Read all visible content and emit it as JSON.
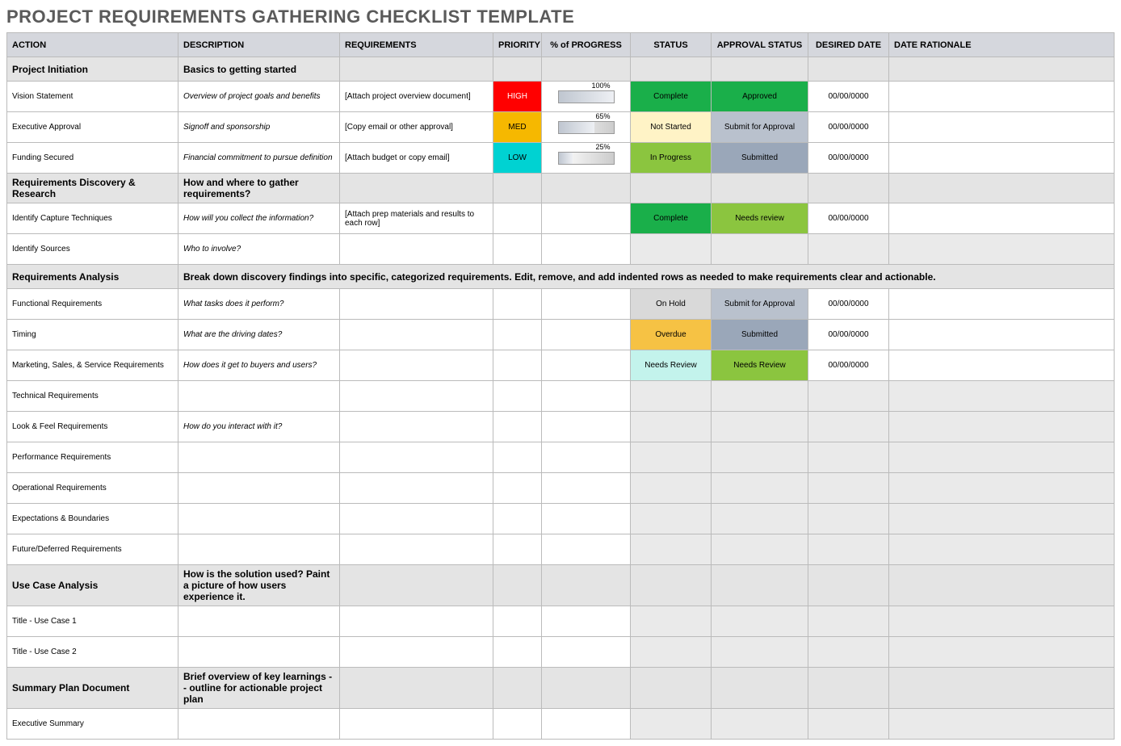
{
  "title": "PROJECT REQUIREMENTS GATHERING CHECKLIST TEMPLATE",
  "headers": {
    "action": "ACTION",
    "description": "DESCRIPTION",
    "requirements": "REQUIREMENTS",
    "priority": "PRIORITY",
    "progress": "% of PROGRESS",
    "status": "STATUS",
    "approval": "APPROVAL STATUS",
    "date": "DESIRED DATE",
    "rationale": "DATE RATIONALE"
  },
  "rows": [
    {
      "type": "section",
      "action": "Project Initiation",
      "description": "Basics to getting started"
    },
    {
      "type": "data",
      "action": "Vision Statement",
      "description": "Overview of project goals and benefits",
      "requirements": "[Attach project overview document]",
      "priority": "HIGH",
      "progress": 100,
      "status": "Complete",
      "approval": "Approved",
      "date": "00/00/0000"
    },
    {
      "type": "data",
      "action": "Executive Approval",
      "description": "Signoff and sponsorship",
      "requirements": "[Copy email or other approval]",
      "priority": "MED",
      "progress": 65,
      "status": "Not Started",
      "approval": "Submit for Approval",
      "date": "00/00/0000"
    },
    {
      "type": "data",
      "action": "Funding Secured",
      "description": "Financial commitment to pursue definition",
      "requirements": "[Attach budget or copy email]",
      "priority": "LOW",
      "progress": 25,
      "status": "In Progress",
      "approval": "Submitted",
      "date": "00/00/0000"
    },
    {
      "type": "section",
      "action": "Requirements Discovery & Research",
      "description": "How and where to gather requirements?"
    },
    {
      "type": "data",
      "action": "Identify Capture Techniques",
      "description": "How will you collect the information?",
      "requirements": "[Attach prep materials and results to each row]",
      "status": "Complete",
      "approval": "Needs review",
      "date": "00/00/0000"
    },
    {
      "type": "data",
      "action": "Identify Sources",
      "description": "Who to involve?",
      "emptyStatus": true
    },
    {
      "type": "section",
      "action": "Requirements Analysis",
      "description": "Break down discovery findings into specific, categorized requirements. Edit, remove, and add indented rows as needed to make requirements clear and actionable.",
      "descSpan": 8
    },
    {
      "type": "data",
      "action": "Functional Requirements",
      "description": "What tasks does it perform?",
      "status": "On Hold",
      "approval": "Submit for Approval",
      "date": "00/00/0000"
    },
    {
      "type": "data",
      "action": "Timing",
      "description": "What are the driving dates?",
      "status": "Overdue",
      "approval": "Submitted",
      "date": "00/00/0000"
    },
    {
      "type": "data",
      "action": "Marketing, Sales, & Service Requirements",
      "description": "How does it get to buyers and users?",
      "status": "Needs Review",
      "approval": "Needs Review",
      "date": "00/00/0000"
    },
    {
      "type": "data",
      "action": "Technical Requirements",
      "emptyStatus": true
    },
    {
      "type": "data",
      "action": "Look & Feel Requirements",
      "description": "How do you interact with it?",
      "emptyStatus": true
    },
    {
      "type": "data",
      "action": "Performance Requirements",
      "emptyStatus": true
    },
    {
      "type": "data",
      "action": "Operational Requirements",
      "emptyStatus": true
    },
    {
      "type": "data",
      "action": "Expectations & Boundaries",
      "emptyStatus": true
    },
    {
      "type": "data",
      "action": "Future/Deferred Requirements",
      "emptyStatus": true
    },
    {
      "type": "section",
      "action": "Use Case Analysis",
      "description": "How is the solution used? Paint a picture of how users experience it."
    },
    {
      "type": "data",
      "action": "Title - Use Case 1",
      "emptyStatus": true
    },
    {
      "type": "data",
      "action": "Title - Use Case 2",
      "emptyStatus": true
    },
    {
      "type": "section",
      "action": "Summary Plan Document",
      "description": "Brief overview of key learnings -- outline for actionable project plan"
    },
    {
      "type": "data",
      "action": "Executive Summary",
      "emptyStatus": true
    }
  ]
}
